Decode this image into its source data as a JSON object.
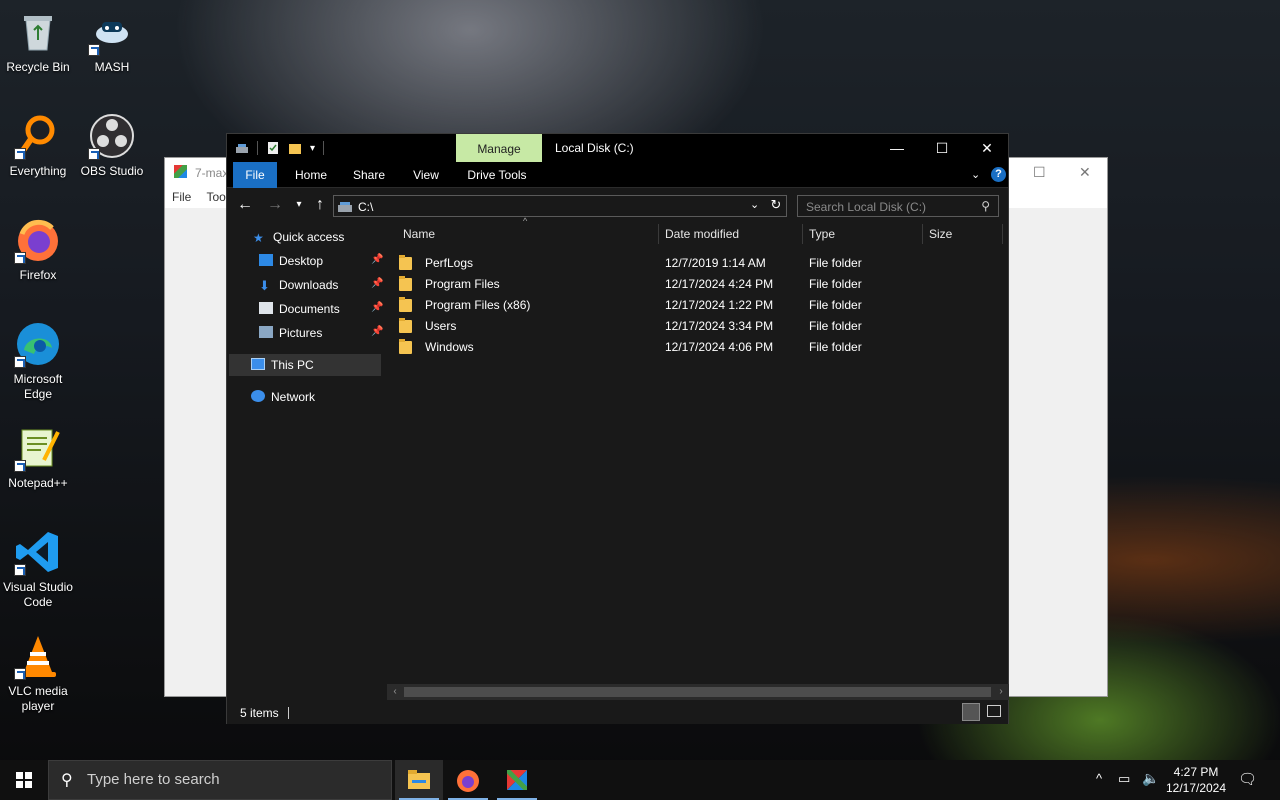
{
  "desktop": {
    "icons": [
      {
        "label": "Recycle Bin"
      },
      {
        "label": "MASH"
      },
      {
        "label": "Everything"
      },
      {
        "label": "OBS Studio"
      },
      {
        "label": "Firefox"
      },
      {
        "label": "Microsoft Edge"
      },
      {
        "label": "Notepad++"
      },
      {
        "label": "Visual Studio Code"
      },
      {
        "label": "VLC media player"
      }
    ]
  },
  "background_window": {
    "title": "7-max",
    "menu": [
      "File",
      "Tool"
    ]
  },
  "explorer": {
    "title": "Local Disk (C:)",
    "contextual_tab": "Manage",
    "ribbon_tabs": [
      "File",
      "Home",
      "Share",
      "View",
      "Drive Tools"
    ],
    "address": "C:\\",
    "search_placeholder": "Search Local Disk (C:)",
    "nav": {
      "quick_access": "Quick access",
      "pinned": [
        "Desktop",
        "Downloads",
        "Documents",
        "Pictures"
      ],
      "this_pc": "This PC",
      "network": "Network"
    },
    "columns": [
      "Name",
      "Date modified",
      "Type",
      "Size"
    ],
    "rows": [
      {
        "name": "PerfLogs",
        "date": "12/7/2019 1:14 AM",
        "type": "File folder",
        "size": ""
      },
      {
        "name": "Program Files",
        "date": "12/17/2024 4:24 PM",
        "type": "File folder",
        "size": ""
      },
      {
        "name": "Program Files (x86)",
        "date": "12/17/2024 1:22 PM",
        "type": "File folder",
        "size": ""
      },
      {
        "name": "Users",
        "date": "12/17/2024 3:34 PM",
        "type": "File folder",
        "size": ""
      },
      {
        "name": "Windows",
        "date": "12/17/2024 4:06 PM",
        "type": "File folder",
        "size": ""
      }
    ],
    "status": "5 items"
  },
  "taskbar": {
    "search_placeholder": "Type here to search",
    "time": "4:27 PM",
    "date": "12/17/2024"
  },
  "colors": {
    "accent": "#1a6fc4",
    "manage_tab": "#c7e9a5",
    "explorer_bg": "#191919",
    "folder": "#f5c451"
  }
}
